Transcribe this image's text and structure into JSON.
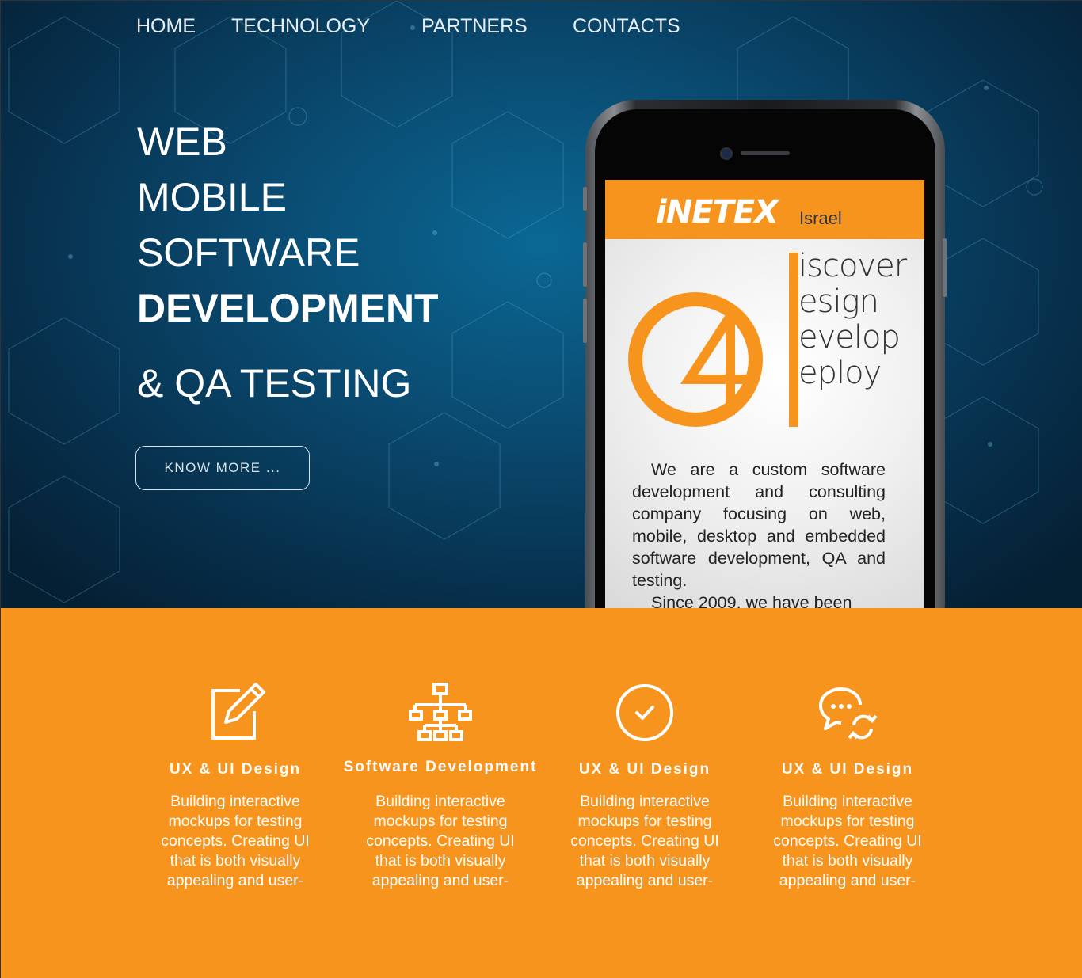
{
  "nav": {
    "items": [
      "HOME",
      "TECHNOLOGY",
      "PARTNERS",
      "CONTACTS"
    ]
  },
  "hero": {
    "lines": [
      "WEB",
      "MOBILE",
      "SOFTWARE",
      "DEVELOPMENT"
    ],
    "subline": "& QA TESTING",
    "button_label": "KNOW MORE ..."
  },
  "phone_screen": {
    "logo": "iNETEX",
    "logo_sub": "Israel",
    "tag_words": [
      "iscover",
      "esign",
      "evelop",
      "eploy"
    ],
    "paragraph_1": "We are a custom software development and consulting company focusing on web, mobile, desktop and embedded software development, QA and testing.",
    "paragraph_2": "Since 2009, we have been"
  },
  "features": [
    {
      "icon": "edit-icon",
      "title": "UX & UI Design",
      "desc": "Building interactive mockups for testing concepts. Creating UI that is both visually appealing and user-"
    },
    {
      "icon": "sitemap-icon",
      "title": "Software Development",
      "desc": "Building interactive mockups for testing concepts. Creating UI that is both visually appealing and user-"
    },
    {
      "icon": "check-circle-icon",
      "title": "UX & UI Design",
      "desc": "Building interactive mockups for testing concepts. Creating UI that is both visually appealing and user-"
    },
    {
      "icon": "chat-sync-icon",
      "title": "UX & UI Design",
      "desc": "Building interactive mockups for testing concepts. Creating UI that is both visually appealing and user-"
    }
  ],
  "colors": {
    "accent": "#f7941d",
    "hero_bg": "#0a4a70",
    "text_light": "#ffffff"
  }
}
